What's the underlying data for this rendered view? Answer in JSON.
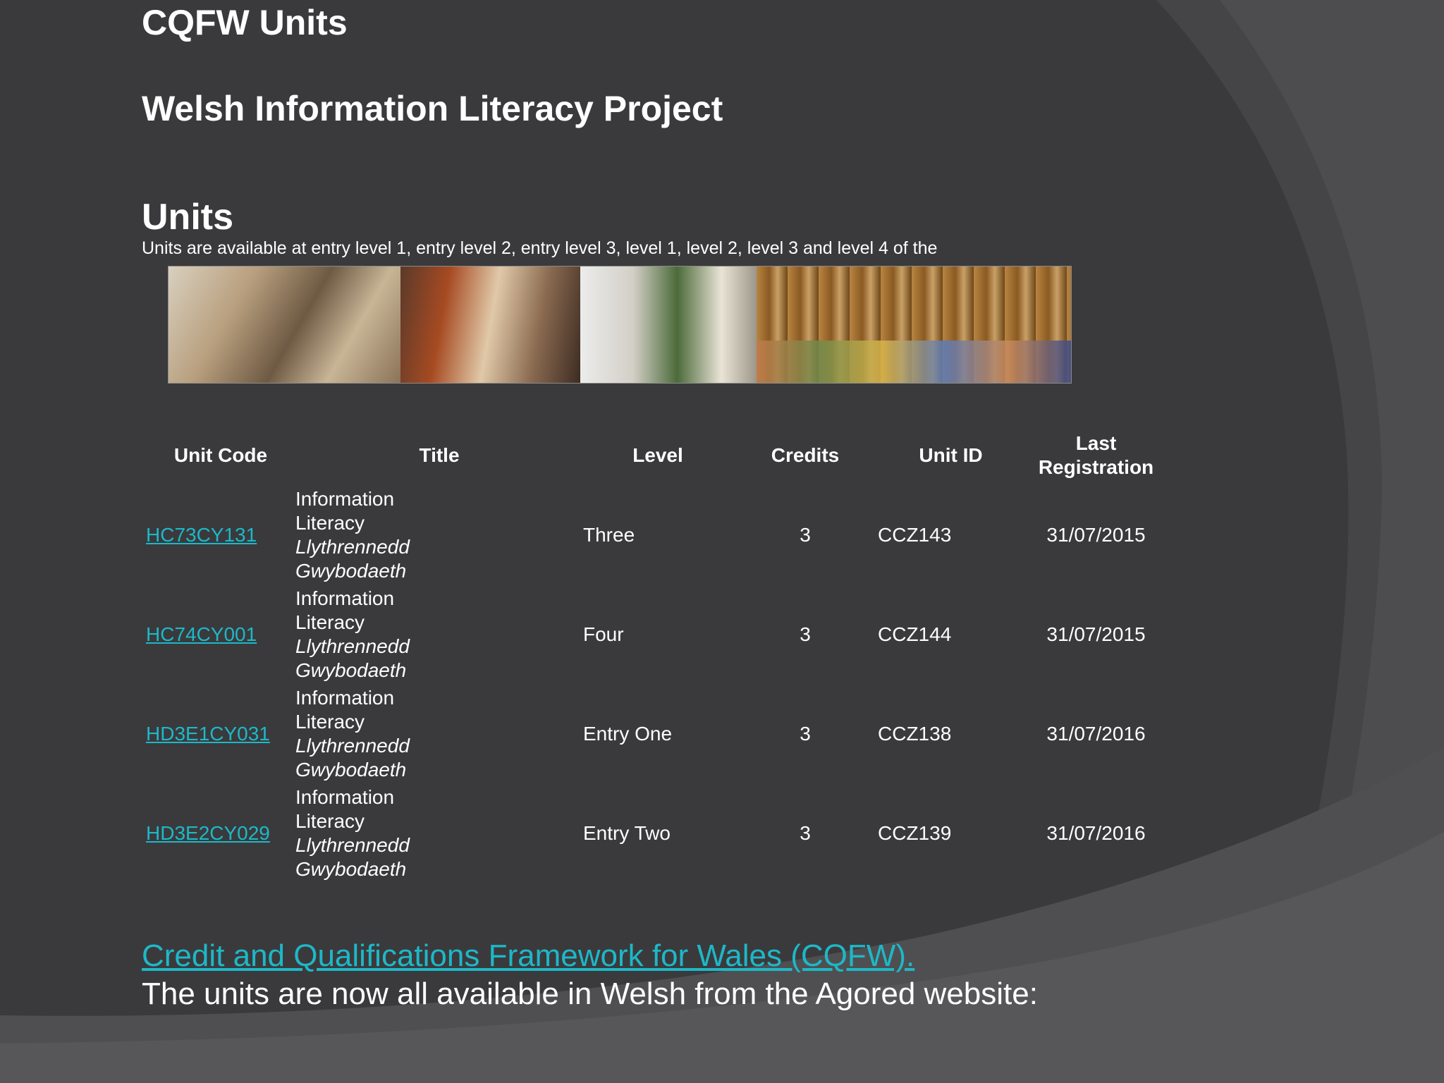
{
  "colors": {
    "background": "#3a3a3c",
    "swoosh_light": "#4a4a4c",
    "swoosh_lighter": "#58585a",
    "text": "#ffffff",
    "link": "#1db8c8"
  },
  "header": {
    "title": "CQFW Units",
    "subtitle": "Welsh Information Literacy Project"
  },
  "units_section": {
    "heading": "Units",
    "description": "Units are available at entry level 1, entry level 2, entry level 3, level 1, level 2, level 3 and level 4 of the"
  },
  "banner": {
    "alt": "photo-collage"
  },
  "table": {
    "headers": {
      "unit_code": "Unit Code",
      "title": "Title",
      "level": "Level",
      "credits": "Credits",
      "unit_id": "Unit ID",
      "last_registration": "Last Registration"
    },
    "rows": [
      {
        "unit_code": "HC73CY131",
        "title_en": "Information Literacy",
        "title_cy": "Llythrennedd Gwybodaeth",
        "level": "Three",
        "credits": "3",
        "unit_id": "CCZ143",
        "last_registration": "31/07/2015"
      },
      {
        "unit_code": "HC74CY001",
        "title_en": "Information Literacy",
        "title_cy": "Llythrennedd Gwybodaeth",
        "level": "Four",
        "credits": "3",
        "unit_id": "CCZ144",
        "last_registration": "31/07/2015"
      },
      {
        "unit_code": "HD3E1CY031",
        "title_en": "Information Literacy",
        "title_cy": "Llythrennedd Gwybodaeth",
        "level": "Entry One",
        "credits": "3",
        "unit_id": "CCZ138",
        "last_registration": "31/07/2016"
      },
      {
        "unit_code": "HD3E2CY029",
        "title_en": "Information Literacy",
        "title_cy": "Llythrennedd Gwybodaeth",
        "level": "Entry Two",
        "credits": "3",
        "unit_id": "CCZ139",
        "last_registration": "31/07/2016"
      }
    ]
  },
  "footer": {
    "link_text": "Credit and Qualifications Framework for Wales (CQFW).",
    "text": "The units are now all available in Welsh from the Agored website:"
  }
}
